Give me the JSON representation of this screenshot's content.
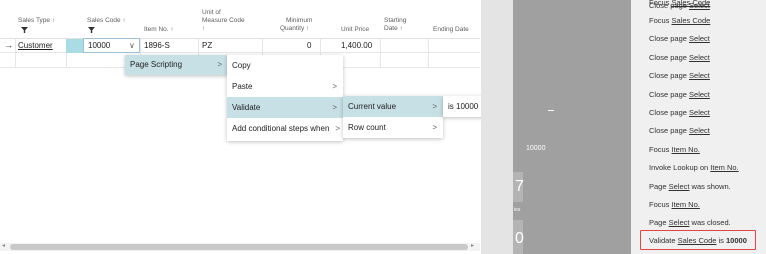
{
  "grid": {
    "headers": {
      "sales_type": "Sales Type ↑",
      "sales_code": "Sales Code ↑",
      "item_no": "Item No. ↑",
      "uom_line1": "Unit of",
      "uom_line2": "Measure Code",
      "uom_line3": "↑",
      "min_qty_line1": "Minimum",
      "min_qty_line2": "Quantity ↑",
      "unit_price": "Unit Price",
      "starting_date_line1": "Starting",
      "starting_date_line2": "Date ↑",
      "ending_date": "Ending Date"
    },
    "row": {
      "indicator": "→",
      "sales_type": "Customer",
      "sales_code": "10000",
      "item_no": "1896-S",
      "uom": "PZ",
      "min_qty": "0",
      "unit_price": "1,400.00"
    }
  },
  "menus": {
    "level1": [
      {
        "label": "Page Scripting",
        "chevron": ">"
      }
    ],
    "level2": [
      {
        "label": "Copy",
        "chevron": ""
      },
      {
        "label": "Paste",
        "chevron": ">"
      },
      {
        "label": "Validate",
        "chevron": ">"
      },
      {
        "label": "Add conditional steps when",
        "chevron": ">"
      }
    ],
    "level3": [
      {
        "label": "Current value",
        "chevron": ">"
      },
      {
        "label": "Row count",
        "chevron": ">"
      }
    ],
    "level4": [
      {
        "label": "is 10000"
      }
    ]
  },
  "middle_panel": {
    "value": "10000",
    "big1": "7",
    "big2": "0",
    "small": "ies"
  },
  "steps": [
    {
      "pre": "Focus ",
      "link": "Sales Code",
      "post": "",
      "bold": ""
    },
    {
      "pre": "Close page ",
      "link": "Select",
      "post": "",
      "bold": ""
    },
    {
      "pre": "Focus ",
      "link": "Sales Code",
      "post": "",
      "bold": ""
    },
    {
      "pre": "Close page ",
      "link": "Select",
      "post": "",
      "bold": ""
    },
    {
      "pre": "Close page ",
      "link": "Select",
      "post": "",
      "bold": ""
    },
    {
      "pre": "Close page ",
      "link": "Select",
      "post": "",
      "bold": ""
    },
    {
      "pre": "Close page ",
      "link": "Select",
      "post": "",
      "bold": ""
    },
    {
      "pre": "Close page ",
      "link": "Select",
      "post": "",
      "bold": ""
    },
    {
      "pre": "Close page ",
      "link": "Select",
      "post": "",
      "bold": ""
    },
    {
      "pre": "Focus ",
      "link": "Item No.",
      "post": "",
      "bold": ""
    },
    {
      "pre": "Invoke Lookup on ",
      "link": "Item No.",
      "post": "",
      "bold": ""
    },
    {
      "pre": "Page ",
      "link": "Select",
      "post": " was shown.",
      "bold": ""
    },
    {
      "pre": "Focus ",
      "link": "Item No.",
      "post": "",
      "bold": ""
    },
    {
      "pre": "Page ",
      "link": "Select",
      "post": " was closed.",
      "bold": ""
    },
    {
      "pre": "Validate ",
      "link": "Sales Code",
      "post": " is ",
      "bold": "10000"
    }
  ],
  "colors": {
    "menu_selected": "#c7e0e6",
    "highlight_border": "#e04646",
    "focus_cell": "#a9dce3"
  }
}
